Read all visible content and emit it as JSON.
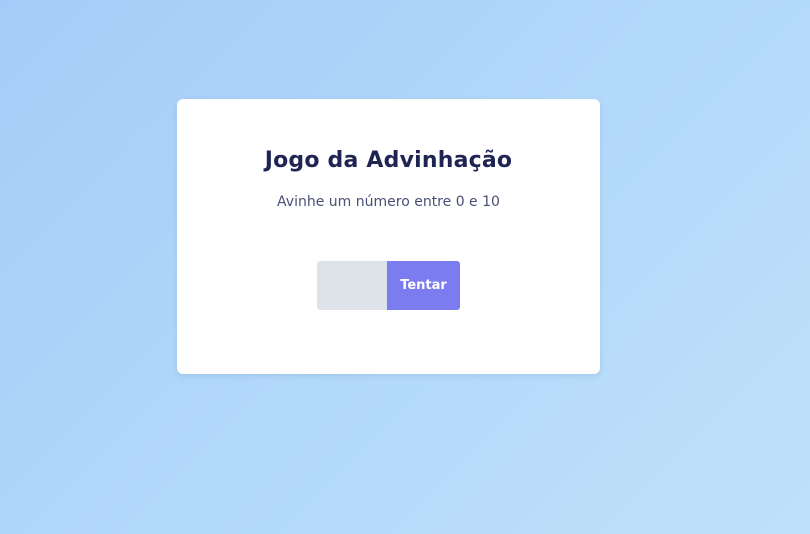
{
  "game": {
    "title": "Jogo da Advinhação",
    "subtitle": "Avinhe um número entre 0 e 10",
    "input": {
      "value": "",
      "placeholder": ""
    },
    "try_button_label": "Tentar"
  },
  "colors": {
    "background_start": "#a6cbf8",
    "background_end": "#bfe0fa",
    "card": "#ffffff",
    "title": "#1e2553",
    "subtitle": "#4a5075",
    "input_background": "#dee3ea",
    "button": "#7b7cf0",
    "button_text": "#ffffff"
  }
}
